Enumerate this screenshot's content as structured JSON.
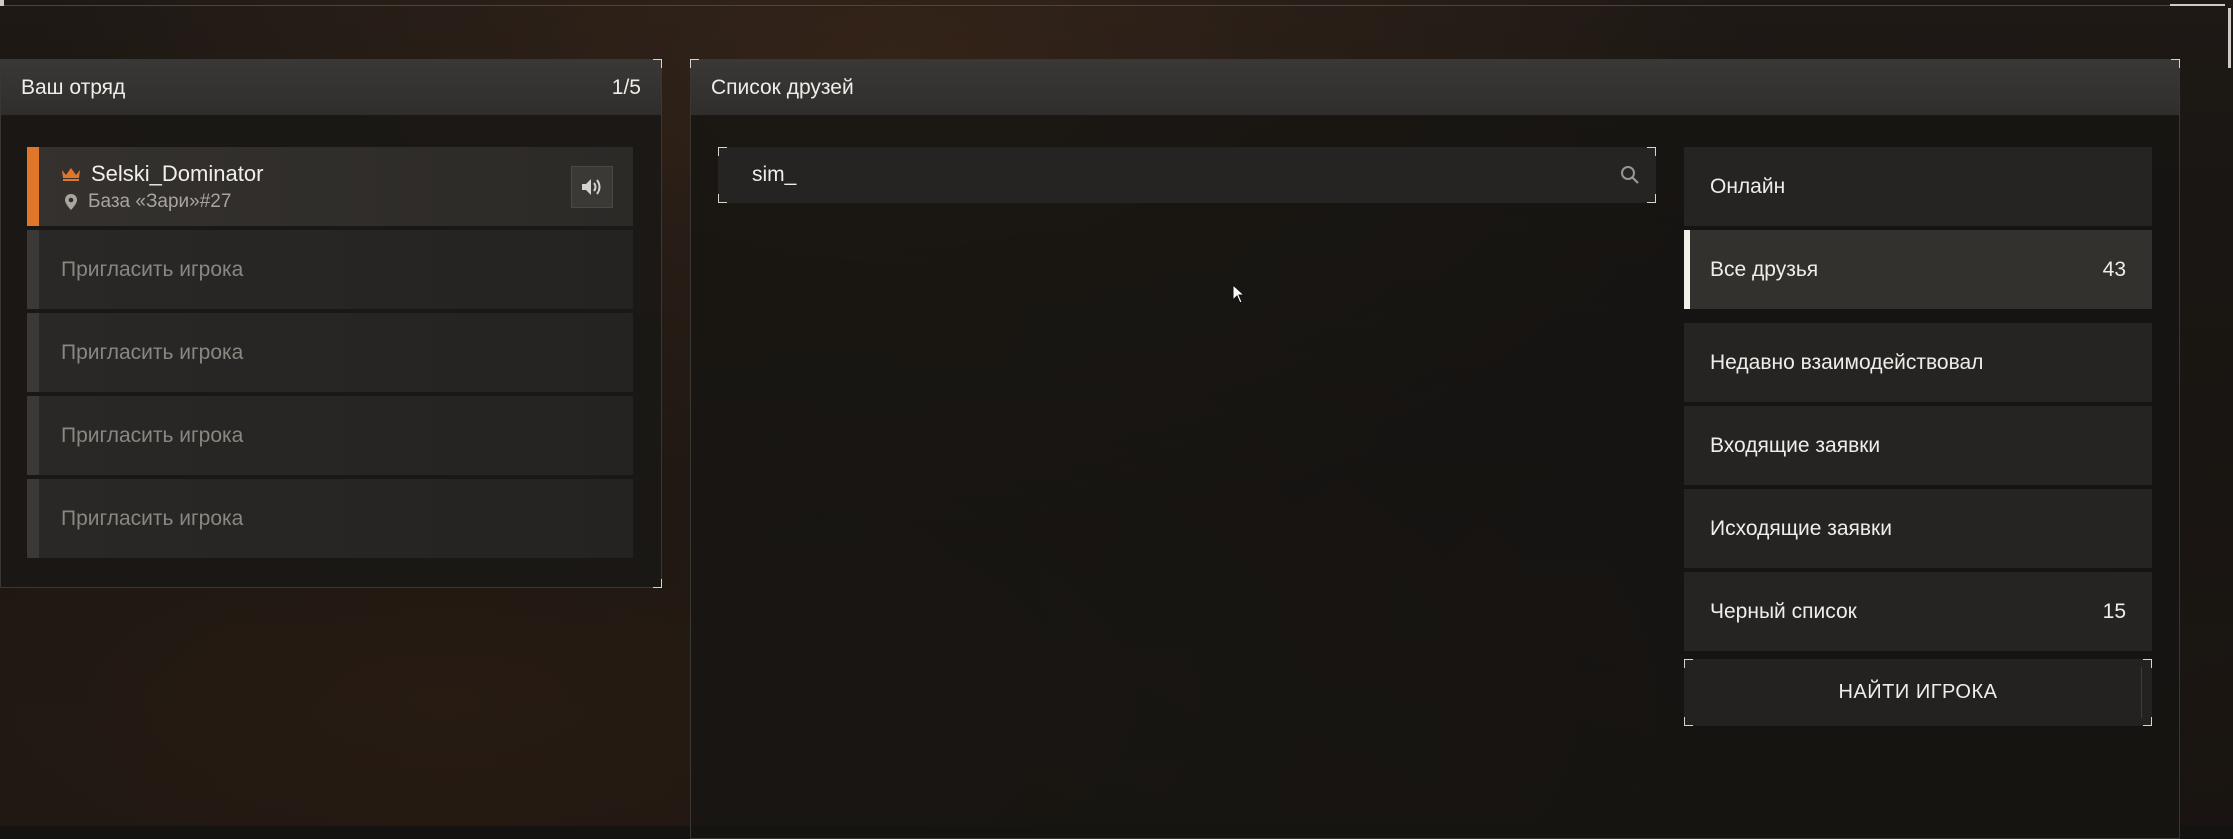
{
  "colors": {
    "leader_accent": "#e0762a",
    "active_filter": "#f3f0ea",
    "panel_bg": "#262422"
  },
  "squad": {
    "title": "Ваш отряд",
    "count": "1/5",
    "leader": {
      "name": "Selski_Dominator",
      "location": "База «Зари»#27",
      "icon": "crown-icon",
      "voice_icon": "speaker-icon"
    },
    "invite_slots": [
      {
        "label": "Пригласить игрока"
      },
      {
        "label": "Пригласить игрока"
      },
      {
        "label": "Пригласить игрока"
      },
      {
        "label": "Пригласить игрока"
      }
    ]
  },
  "friends": {
    "title": "Список друзей",
    "search": {
      "value": "sim_",
      "icon": "search-icon"
    },
    "filters": [
      {
        "label": "Онлайн",
        "count": ""
      },
      {
        "label": "Все друзья",
        "count": "43"
      },
      {
        "label": "Недавно взаимодействовал",
        "count": ""
      },
      {
        "label": "Входящие заявки",
        "count": ""
      },
      {
        "label": "Исходящие заявки",
        "count": ""
      },
      {
        "label": "Черный список",
        "count": "15"
      }
    ],
    "find_button": "НАЙТИ ИГРОКА"
  }
}
